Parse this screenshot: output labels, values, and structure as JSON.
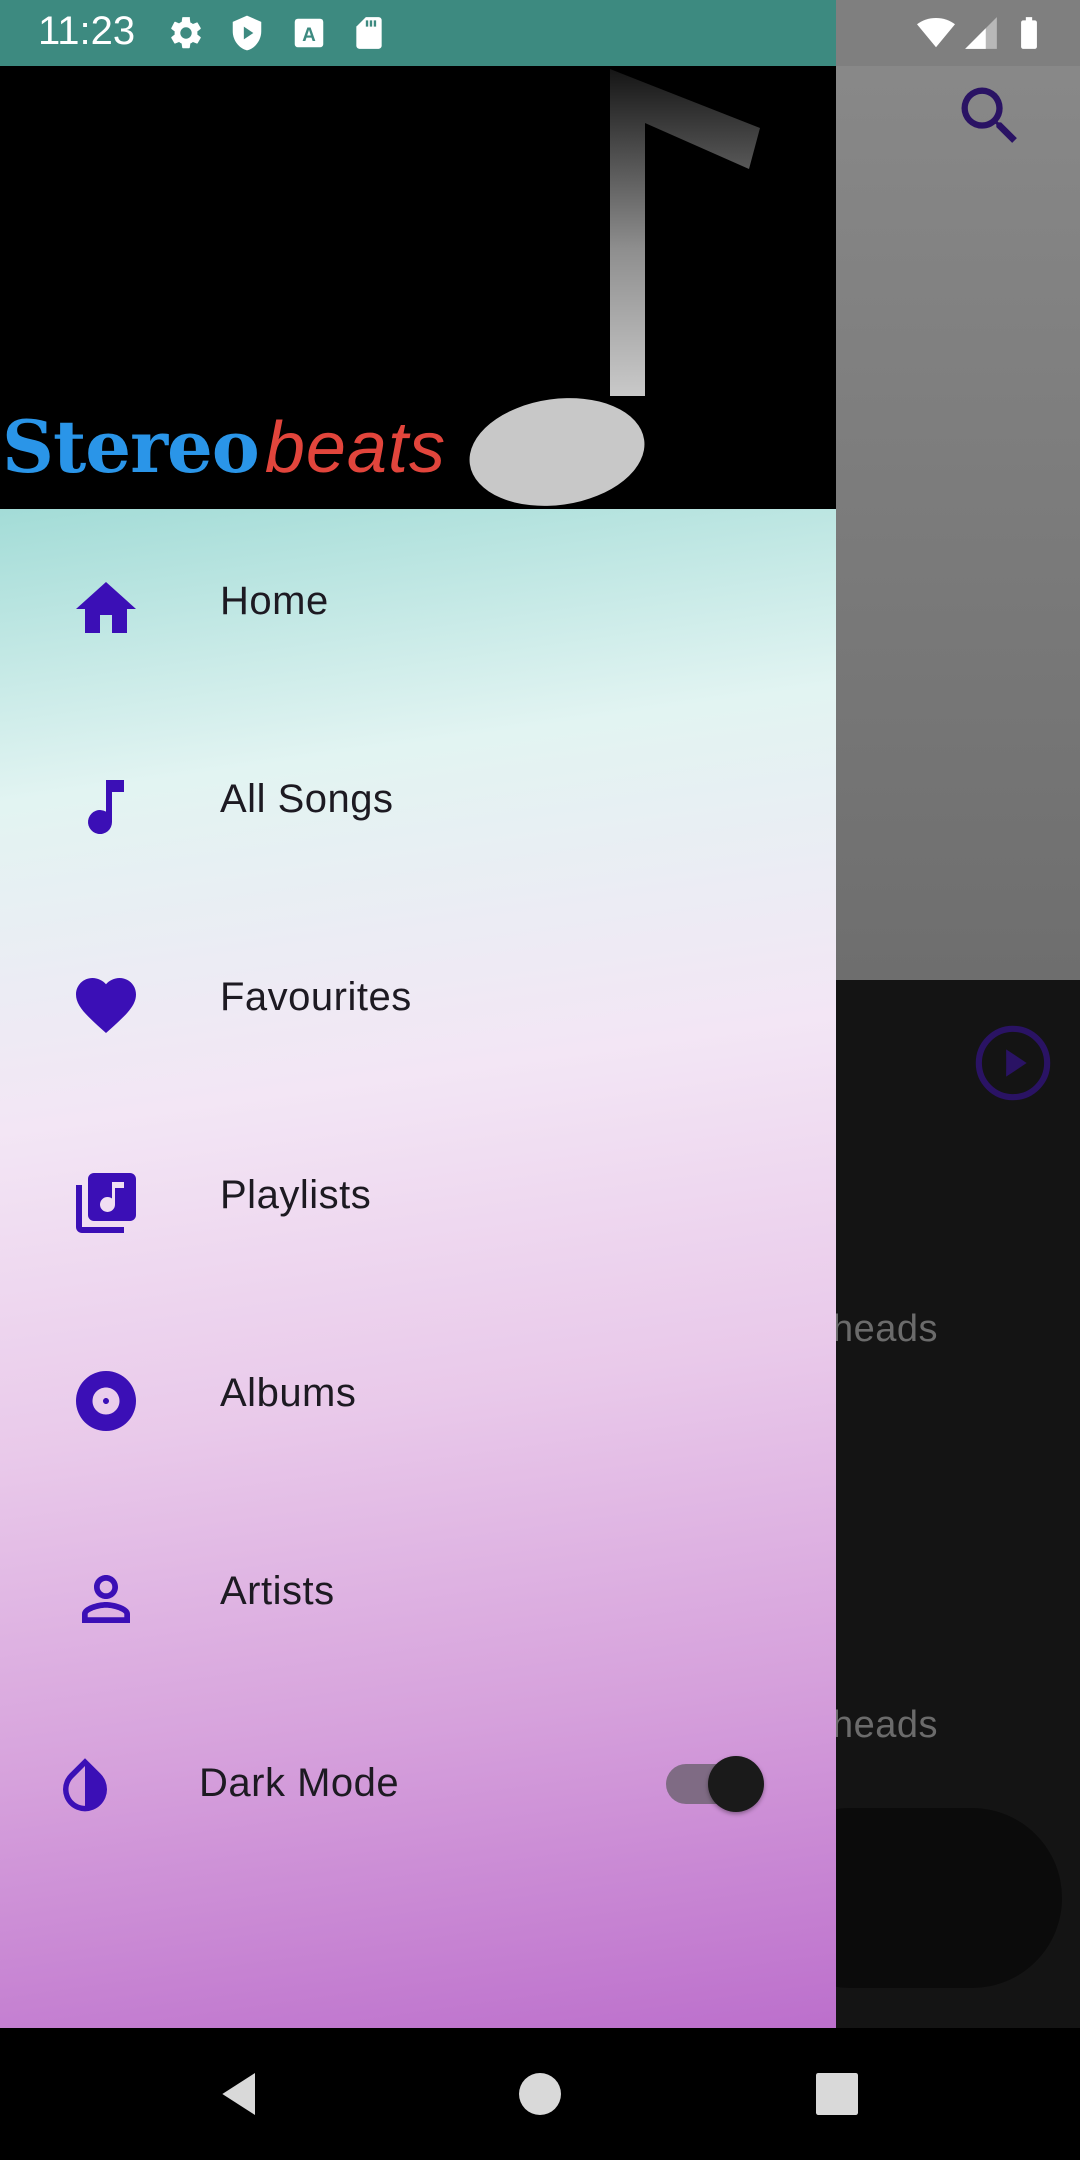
{
  "status_bar": {
    "time": "11:23",
    "left_icons": [
      "settings-icon",
      "shield-play-icon",
      "text-a-icon",
      "sd-card-icon"
    ],
    "right_icons": [
      "wifi-icon",
      "cell-signal-icon",
      "battery-icon"
    ]
  },
  "drawer": {
    "header": {
      "logo_part1": "Stereo",
      "logo_part2": "beats",
      "logo_colors": {
        "stereo": "#2a95e8",
        "beats": "#e2453c"
      }
    },
    "menu": [
      {
        "label": "Home",
        "icon": "home-icon"
      },
      {
        "label": "All Songs",
        "icon": "music-note-icon"
      },
      {
        "label": "Favourites",
        "icon": "heart-icon"
      },
      {
        "label": "Playlists",
        "icon": "library-music-icon"
      },
      {
        "label": "Albums",
        "icon": "album-icon"
      },
      {
        "label": "Artists",
        "icon": "person-icon"
      }
    ],
    "dark_mode": {
      "label": "Dark Mode",
      "icon": "invert-colors-icon",
      "enabled": true
    },
    "accent_color": "#3b0fb6"
  },
  "background": {
    "partial_text_1": "heads",
    "partial_text_2": "heads",
    "icons": [
      "search-icon",
      "play-circle-icon"
    ]
  },
  "nav_bar": {
    "buttons": [
      "back-icon",
      "home-circle-icon",
      "recents-icon"
    ]
  }
}
